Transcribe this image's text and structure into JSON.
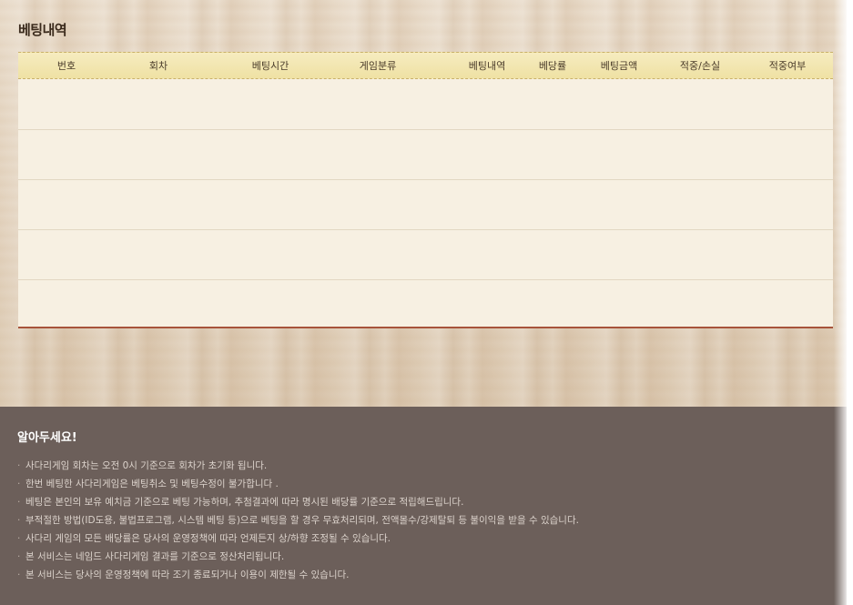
{
  "section": {
    "title": "베팅내역"
  },
  "table": {
    "columns": [
      "번호",
      "회차",
      "베팅시간",
      "게임분류",
      "베팅내역",
      "베당률",
      "베팅금액",
      "적중/손실",
      "적중여부"
    ],
    "rows": [
      [
        "",
        "",
        "",
        "",
        "",
        "",
        "",
        "",
        ""
      ],
      [
        "",
        "",
        "",
        "",
        "",
        "",
        "",
        "",
        ""
      ],
      [
        "",
        "",
        "",
        "",
        "",
        "",
        "",
        "",
        ""
      ],
      [
        "",
        "",
        "",
        "",
        "",
        "",
        "",
        "",
        ""
      ],
      [
        "",
        "",
        "",
        "",
        "",
        "",
        "",
        "",
        ""
      ]
    ]
  },
  "notice": {
    "title": "알아두세요!",
    "bullet": "·",
    "items": [
      "사다리게임 회차는 오전 0시 기준으로 회차가 초기화 됩니다.",
      "한번 베팅한 사다리게임은 베팅취소 및 베팅수정이 불가합니다 .",
      "베팅은 본인의 보유 예치금 기준으로 베팅 가능하며, 추첨결과에 따라 명시된 배당률 기준으로 적립해드립니다.",
      "부적절한 방법(ID도용, 불법프로그램, 시스템 베팅 등)으로 베팅을 할 경우 무효처리되며, 전액몰수/강제탈퇴 등 불이익을 받을 수 있습니다.",
      "사다리 게임의 모든 배당률은 당사의 운영정책에 따라 언제든지 상/하향 조정될 수 있습니다.",
      "본 서비스는 네임드 사다리게임 결과를 기준으로 정산처리됩니다.",
      "본 서비스는 당사의 운영정책에 따라 조기 종료되거나 이용이 제한될 수 있습니다."
    ]
  }
}
